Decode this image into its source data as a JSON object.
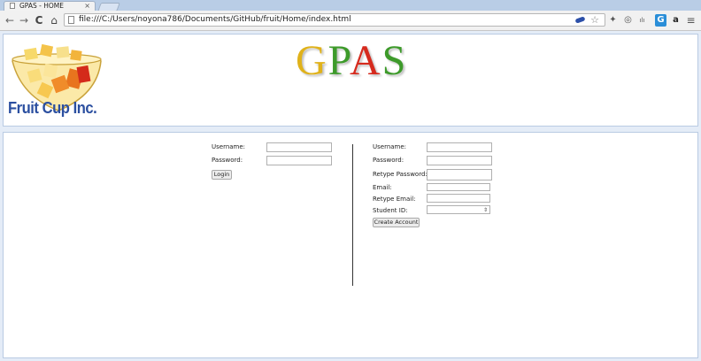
{
  "browser": {
    "tab_title": "GPAS - HOME",
    "tab_close": "×",
    "url": "file:///C:/Users/noyona786/Documents/GitHub/fruit/Home/index.html",
    "nav": {
      "back": "←",
      "forward": "→",
      "reload": "C",
      "home": "⌂"
    },
    "star": "☆",
    "extensions": [
      "✦",
      "◎",
      "ılı",
      "G",
      "a",
      "≡"
    ]
  },
  "header": {
    "logo_text": "Fruit Cup Inc.",
    "title_letters": [
      "G",
      "P",
      "A",
      "S"
    ]
  },
  "login": {
    "username_label": "Username:",
    "password_label": "Password:",
    "login_button": "Login"
  },
  "register": {
    "username_label": "Username:",
    "password_label": "Password:",
    "retype_password_label": "Retype Password:",
    "email_label": "Email:",
    "retype_email_label": "Retype Email:",
    "student_id_label": "Student ID:",
    "spinner_glyph": "⇕",
    "create_button": "Create Account"
  }
}
